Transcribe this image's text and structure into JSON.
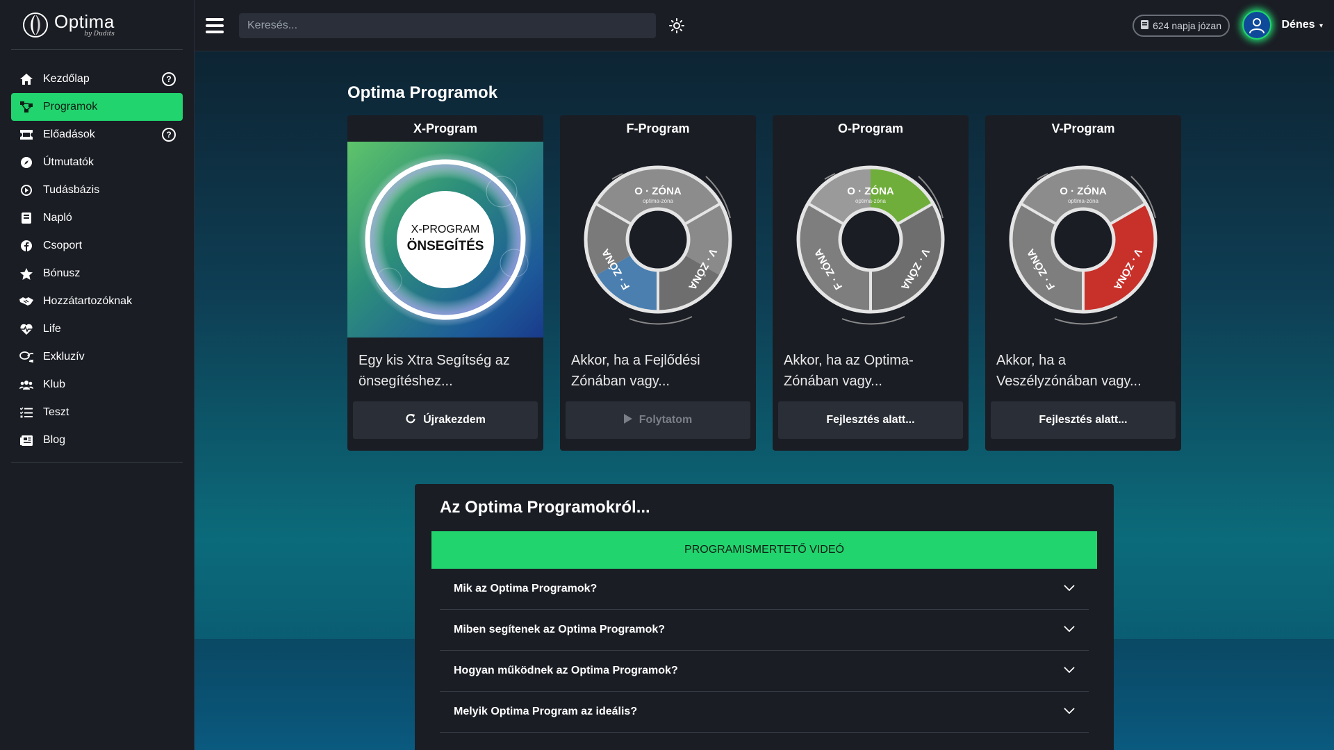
{
  "brand": {
    "title": "Optima",
    "subtitle": "by Dudits"
  },
  "sidebar": {
    "items": [
      {
        "label": "Kezdőlap",
        "icon": "home-icon",
        "help": "?"
      },
      {
        "label": "Programok",
        "icon": "network-icon",
        "active": true
      },
      {
        "label": "Előadások",
        "icon": "ticket-icon",
        "help": "?"
      },
      {
        "label": "Útmutatók",
        "icon": "compass-icon"
      },
      {
        "label": "Tudásbázis",
        "icon": "play-circle-icon"
      },
      {
        "label": "Napló",
        "icon": "book-icon"
      },
      {
        "label": "Csoport",
        "icon": "facebook-icon"
      },
      {
        "label": "Bónusz",
        "icon": "star-icon"
      },
      {
        "label": "Hozzátartozóknak",
        "icon": "handshake-icon"
      },
      {
        "label": "Life",
        "icon": "heart-pulse-icon"
      },
      {
        "label": "Exkluzív",
        "icon": "chat-icon"
      },
      {
        "label": "Klub",
        "icon": "users-icon"
      },
      {
        "label": "Teszt",
        "icon": "list-check-icon"
      },
      {
        "label": "Blog",
        "icon": "newspaper-icon"
      }
    ]
  },
  "topbar": {
    "search_placeholder": "Keresés...",
    "sober_text": "624 napja józan",
    "username": "Dénes"
  },
  "main": {
    "title": "Optima Programok",
    "cards": [
      {
        "title": "X-Program",
        "image_line1": "X-PROGRAM",
        "image_line2": "ÖNSEGÍTÉS",
        "desc": "Egy kis Xtra Segítség az önsegítéshez...",
        "button": "Újrakezdem",
        "button_icon": "refresh-icon"
      },
      {
        "title": "F-Program",
        "highlight": "#4a7fb0",
        "desc": "Akkor, ha a Fejlődési Zónában vagy...",
        "button": "Folytatom",
        "button_icon": "play-icon",
        "disabled": true
      },
      {
        "title": "O-Program",
        "highlight": "#6fae3a",
        "desc": "Akkor, ha az Optima-Zónában vagy...",
        "button": "Fejlesztés alatt..."
      },
      {
        "title": "V-Program",
        "highlight": "#c8302a",
        "desc": "Akkor, ha a Veszélyzónában vagy...",
        "button": "Fejlesztés alatt..."
      }
    ],
    "zone_labels": {
      "o": "O · ZÓNA",
      "o_sub": "optima-zóna",
      "f": "F · ZÓNA",
      "v": "V · ZÓNA"
    }
  },
  "about": {
    "title": "Az Optima Programokról...",
    "video_button": "PROGRAMISMERTETŐ VIDEÓ",
    "faq": [
      "Mik az Optima Programok?",
      "Miben segítenek az Optima Programok?",
      "Hogyan működnek az Optima Programok?",
      "Melyik Optima Program az ideális?"
    ]
  },
  "colors": {
    "accent": "#22d46e",
    "panel": "#1a1d24"
  }
}
